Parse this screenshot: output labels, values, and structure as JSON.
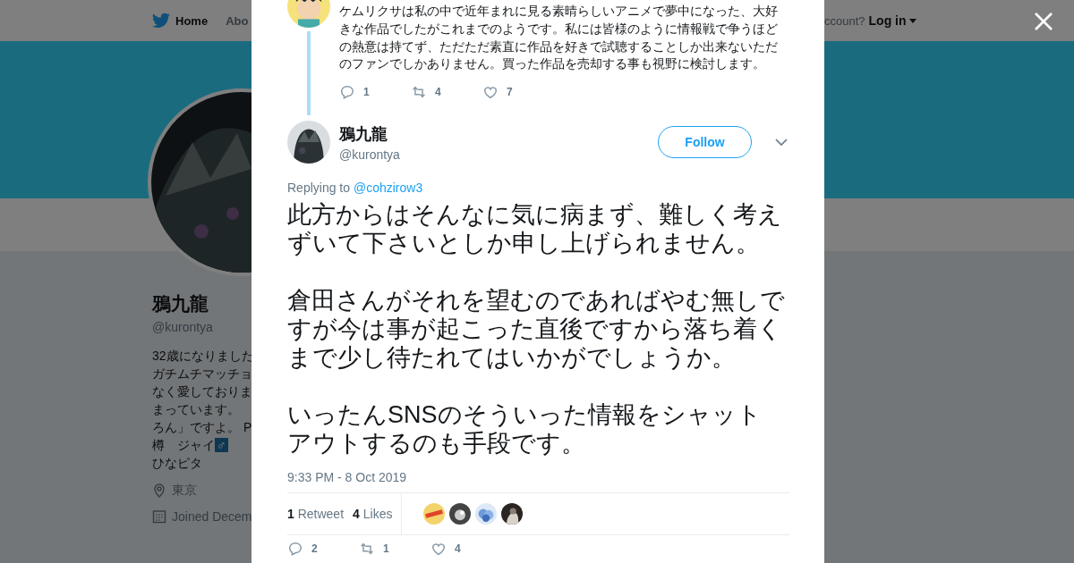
{
  "nav": {
    "items": [
      {
        "label": "Home",
        "selected": true
      },
      {
        "label": "Abo",
        "selected": false
      }
    ],
    "account_prompt": "ccount?",
    "login": "Log in"
  },
  "profile": {
    "name": "鴉九龍",
    "handle": "@kurontya",
    "bio_lines": [
      "32歳になりました",
      "ガチムチマッチョ",
      "なく愛しておりま",
      "まっています。",
      "ろん」ですよ。 P",
      "樽　ジャイ"
    ],
    "bio_badge": "♂",
    "bio_last": "ひなピタ",
    "location": "東京",
    "joined": "Joined Decem"
  },
  "previous_tweet": {
    "text": "ケムリクサは私の中で近年まれに見る素晴らしいアニメで夢中になった、大好きな作品でしたがこれまでのようです。私には皆様のように情報戦で争うほどの熱意は持てず、ただただ素直に作品を好きで試聴することしか出来ないただのファンでしかありません。買った作品を売却する事も視野に検討します。",
    "replies": "1",
    "retweets": "4",
    "likes": "7"
  },
  "tweet": {
    "name": "鴉九龍",
    "handle": "@kurontya",
    "follow": "Follow",
    "replying_prefix": "Replying to",
    "replying_to": "@cohzirow3",
    "paragraphs": [
      "此方からはそんなに気に病まず、難しく考えずいて下さいとしか申し上げられません。",
      "倉田さんがそれを望むのであればやむ無しですが今は事が起こった直後ですから落ち着くまで少し待たれてはいかがでしょうか。",
      "いったんSNSのそういった情報をシャットアウトするのも手段です。"
    ],
    "time": "9:33 PM - 8 Oct 2019",
    "retweet_count": "1",
    "retweet_label": "Retweet",
    "like_count": "4",
    "like_label": "Likes",
    "liker_avatars": [
      {
        "kind": "picture"
      },
      {
        "kind": "picture"
      },
      {
        "kind": "picture"
      },
      {
        "kind": "picture"
      }
    ],
    "replies": "2",
    "retweets": "1",
    "likes": "4"
  }
}
